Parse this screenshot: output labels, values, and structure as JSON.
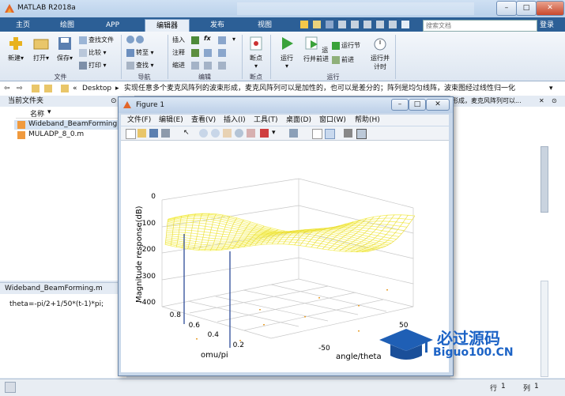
{
  "app": {
    "title": "MATLAB R2018a",
    "colors": {
      "accent": "#2c5f96",
      "surface_yellow": "#f5f060",
      "dip_blue": "#3b57a0"
    }
  },
  "tabs": [
    "主页",
    "绘图",
    "APP",
    "编辑器",
    "发布",
    "视图"
  ],
  "active_tab": "编辑器",
  "search_placeholder": "搜索文档",
  "login_label": "登录",
  "ribbon": {
    "file": {
      "group": "文件",
      "new": "新建",
      "open": "打开",
      "save": "保存",
      "find_files": "查找文件",
      "compare": "比较",
      "print": "打印"
    },
    "nav": {
      "group": "导航",
      "goto": "转至",
      "find": "查找"
    },
    "edit": {
      "group": "编辑",
      "insert": "插入",
      "comment": "注释",
      "indent": "缩进",
      "fx": "fx"
    },
    "breakpoint": {
      "group": "断点",
      "label": "断点"
    },
    "run": {
      "group": "运行",
      "run": "运行",
      "run_advance": "运行并前进",
      "run_section": "运行节",
      "advance": "前进",
      "run_time": "运行并计时"
    }
  },
  "address": {
    "prefix": "«",
    "desktop": "Desktop",
    "marquee": "实现任意多个麦克风阵列的波束形成，麦克风阵列可以是加性的，也可以是差分的；阵列是均匀线阵，波束图经过线性归一化"
  },
  "right_strip_text": "形成，麦克风阵列可以...",
  "current_folder": {
    "title": "当前文件夹",
    "name_col": "名称",
    "files": [
      "Wideband_BeamForming.m",
      "MULADP_8_0.m"
    ]
  },
  "details": {
    "title": "Wideband_BeamForming.m",
    "code": "theta=-pi/2+1/50*(t-1)*pi;"
  },
  "status": {
    "line_label": "行",
    "line": "1",
    "col_label": "列",
    "col": "1"
  },
  "watermark": {
    "text": "必过源码",
    "sub": "Biguo100.CN"
  },
  "figure": {
    "title": "Figure 1",
    "menus": [
      "文件(F)",
      "编辑(E)",
      "查看(V)",
      "插入(I)",
      "工具(T)",
      "桌面(D)",
      "窗口(W)",
      "帮助(H)"
    ]
  },
  "chart_data": {
    "type": "surface",
    "zlabel": "Magnitude response(dB)",
    "xlabel": "angle/theta",
    "ylabel": "omu/pi",
    "z_ticks": [
      "0",
      "-100",
      "-200",
      "-300",
      "-400"
    ],
    "zlim": [
      -400,
      0
    ],
    "y_ticks": [
      "0.8",
      "0.6",
      "0.4",
      "0.2"
    ],
    "x_ticks": [
      "-50",
      "50"
    ],
    "series": [
      {
        "values_note_free": true
      }
    ],
    "grid": true
  }
}
